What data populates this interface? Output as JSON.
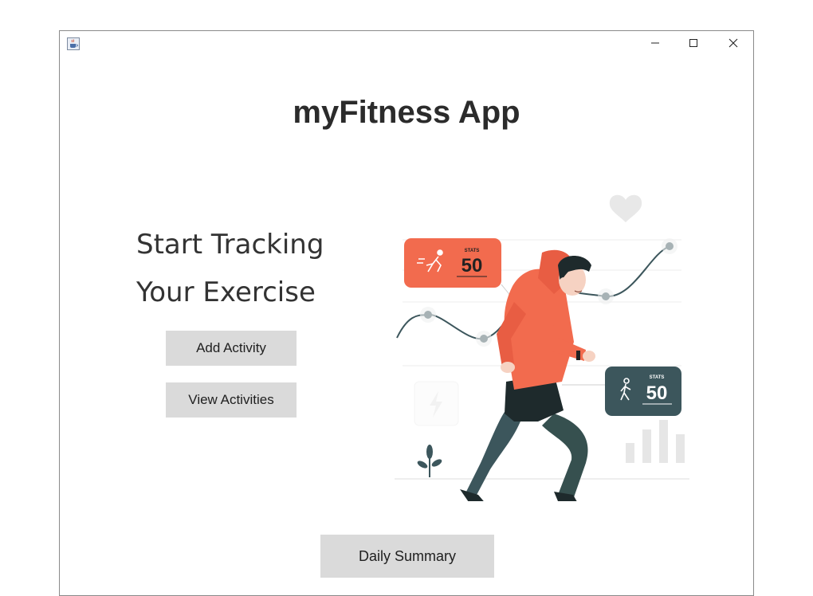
{
  "window": {
    "icon": "java-cup-icon",
    "controls": {
      "minimize": "minimize-icon",
      "maximize": "maximize-icon",
      "close": "close-icon"
    }
  },
  "app": {
    "title": "myFitness App",
    "headline_line1": "Start Tracking",
    "headline_line2": "Your Exercise"
  },
  "buttons": {
    "add_activity": "Add Activity",
    "view_activities": "View Activities",
    "daily_summary": "Daily Summary"
  },
  "illustration": {
    "stat_card_1": {
      "label": "STATS",
      "value": "50",
      "color": "#f26b4e"
    },
    "stat_card_2": {
      "label": "STATS",
      "value": "50",
      "color": "#3c565c"
    },
    "colors": {
      "hoodie": "#f26b4e",
      "pants": "#3c565c",
      "accent": "#3c565c"
    }
  }
}
